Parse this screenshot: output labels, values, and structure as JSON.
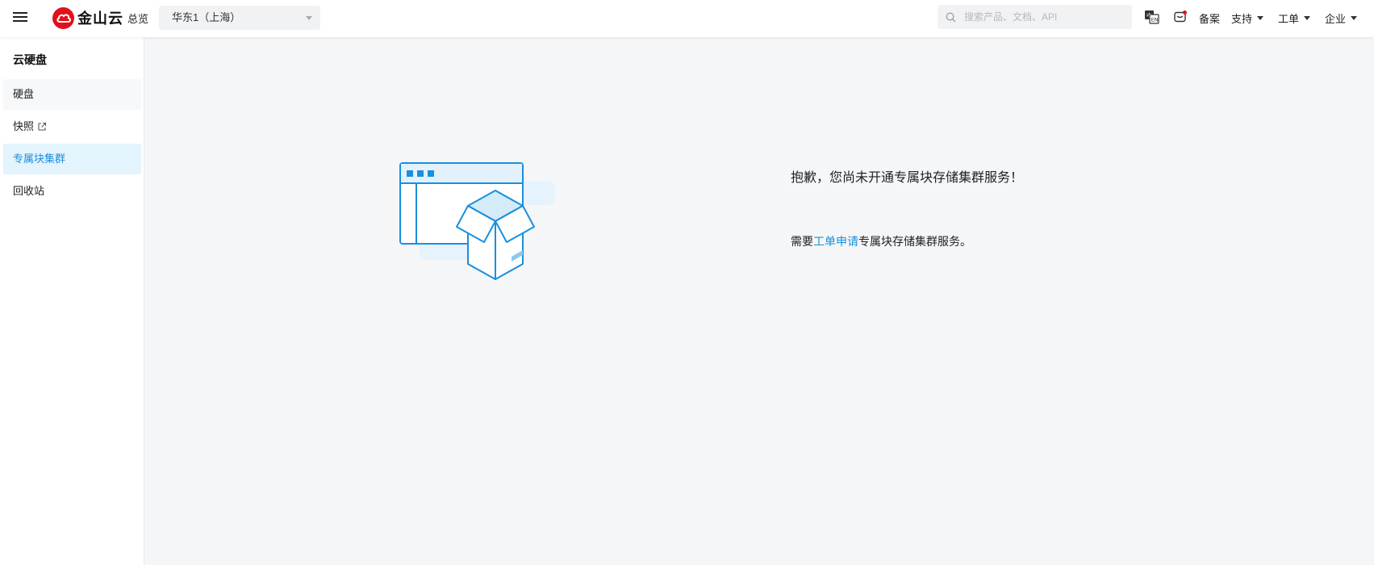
{
  "header": {
    "logo_text": "金山云",
    "overview_label": "总览",
    "region_value": "华东1（上海）",
    "search_placeholder": "搜索产品、文档、API",
    "beian_label": "备案",
    "support_label": "支持",
    "ticket_label": "工单",
    "enterprise_label": "企业",
    "brand_color": "#e1101a"
  },
  "sidebar": {
    "title": "云硬盘",
    "items": [
      {
        "label": "硬盘"
      },
      {
        "label": "快照",
        "external": true
      },
      {
        "label": "专属块集群",
        "active": true
      },
      {
        "label": "回收站"
      }
    ],
    "active_color": "#1a8fdc"
  },
  "main": {
    "title": "抱歉，您尚未开通专属块存储集群服务！",
    "body_prefix": "需要",
    "body_link": "工单申请",
    "body_suffix": "专属块存储集群服务。",
    "link_color": "#1a8fdc"
  }
}
